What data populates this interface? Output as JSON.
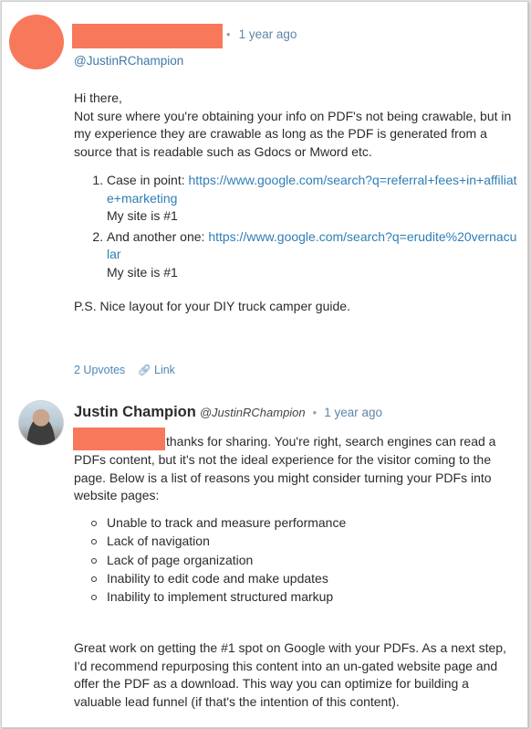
{
  "comment1": {
    "time": "1 year ago",
    "mention": "@JustinRChampion",
    "greeting": "Hi there,",
    "intro": "Not sure where you're obtaining your info on PDF's not being crawable, but in my experience they are crawable as long as the PDF is generated from a source that is readable such as Gdocs or Mword etc.",
    "items": [
      {
        "prefix": "Case in point: ",
        "url": "https://www.google.com/search?q=referral+fees+in+affiliate+marketing",
        "note": "My site is #1"
      },
      {
        "prefix": "And another one: ",
        "url": "https://www.google.com/search?q=erudite%20vernacular",
        "note": "My site is #1"
      }
    ],
    "ps": "P.S. Nice layout for your DIY truck camper guide.",
    "upvotes": "2 Upvotes",
    "link_label": "Link"
  },
  "comment2": {
    "author": "Justin Champion",
    "handle": "@JustinRChampion",
    "time": "1 year ago",
    "intro": "thanks for sharing. You're right, search engines can read a PDFs content, but it's not the ideal experience for the visitor coming to the page. Below is a list of reasons you might consider turning your PDFs into website pages:",
    "reasons": [
      "Unable to track and measure performance",
      "Lack of navigation",
      "Lack of page organization",
      "Inability to edit code and make updates",
      "Inability to implement structured markup"
    ],
    "closing": "Great work on getting the #1 spot on Google with your PDFs. As a next step, I'd recommend repurposing this content into an un-gated website page and offer the PDF as a download. This way you can optimize for building a valuable lead funnel (if that's the intention of this content)."
  },
  "colors": {
    "redaction": "#f8785c",
    "link": "#2f7eb7",
    "meta": "#5f86a8"
  },
  "icons": {
    "link": "link-icon",
    "bullet": "hollow-circle-bullet"
  }
}
